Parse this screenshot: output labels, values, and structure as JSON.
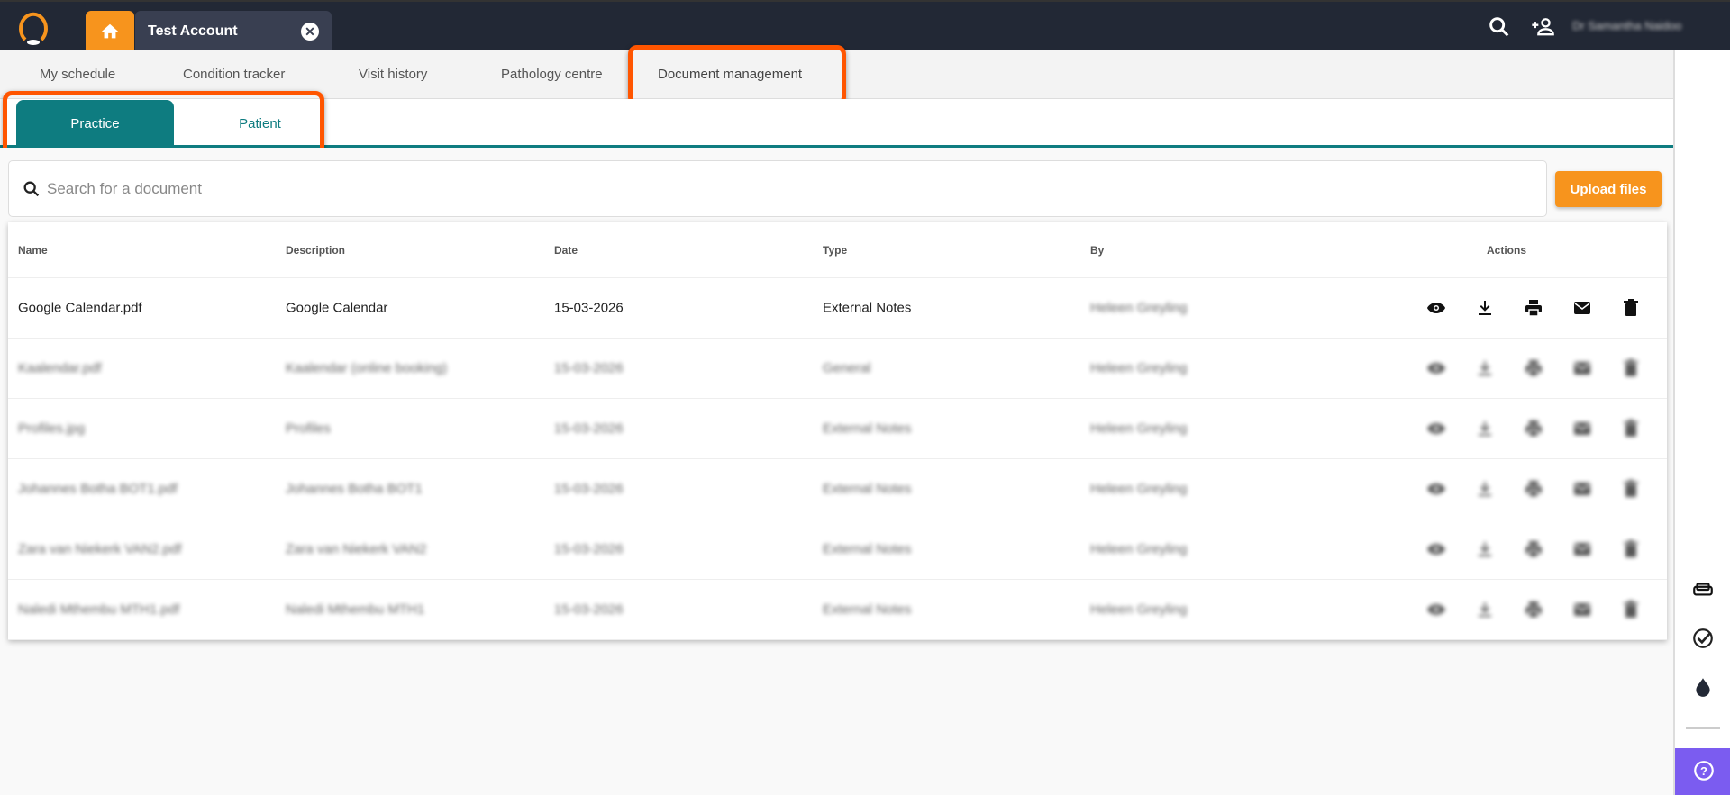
{
  "header": {
    "account_tab": "Test Account",
    "user_name": "Dr Samantha Naidoo"
  },
  "nav": [
    "My schedule",
    "Condition tracker",
    "Visit history",
    "Pathology centre",
    "Document management"
  ],
  "subtabs": {
    "practice": "Practice",
    "patient": "Patient"
  },
  "search": {
    "placeholder": "Search for a document"
  },
  "upload_label": "Upload files",
  "table": {
    "headers": {
      "name": "Name",
      "description": "Description",
      "date": "Date",
      "type": "Type",
      "by": "By",
      "actions": "Actions"
    },
    "rows": [
      {
        "name": "Google Calendar.pdf",
        "description": "Google Calendar",
        "date": "15-03-2026",
        "type": "External Notes",
        "by": "Heleen Greyling"
      },
      {
        "name": "Kaalendar.pdf",
        "description": "Kaalendar (online booking)",
        "date": "15-03-2026",
        "type": "General",
        "by": "Heleen Greyling"
      },
      {
        "name": "Profiles.jpg",
        "description": "Profiles",
        "date": "15-03-2026",
        "type": "External Notes",
        "by": "Heleen Greyling"
      },
      {
        "name": "Johannes Botha BOT1.pdf",
        "description": "Johannes Botha BOT1",
        "date": "15-03-2026",
        "type": "External Notes",
        "by": "Heleen Greyling"
      },
      {
        "name": "Zara van Niekerk VAN2.pdf",
        "description": "Zara van Niekerk VAN2",
        "date": "15-03-2026",
        "type": "External Notes",
        "by": "Heleen Greyling"
      },
      {
        "name": "Naledi Mthembu MTH1.pdf",
        "description": "Naledi Mthembu MTH1",
        "date": "15-03-2026",
        "type": "External Notes",
        "by": "Heleen Greyling"
      }
    ]
  },
  "colors": {
    "accent": "#f7941d",
    "teal": "#0e7c80",
    "topbar": "#222835",
    "highlight": "#ff5500",
    "help": "#7b5cf0"
  }
}
